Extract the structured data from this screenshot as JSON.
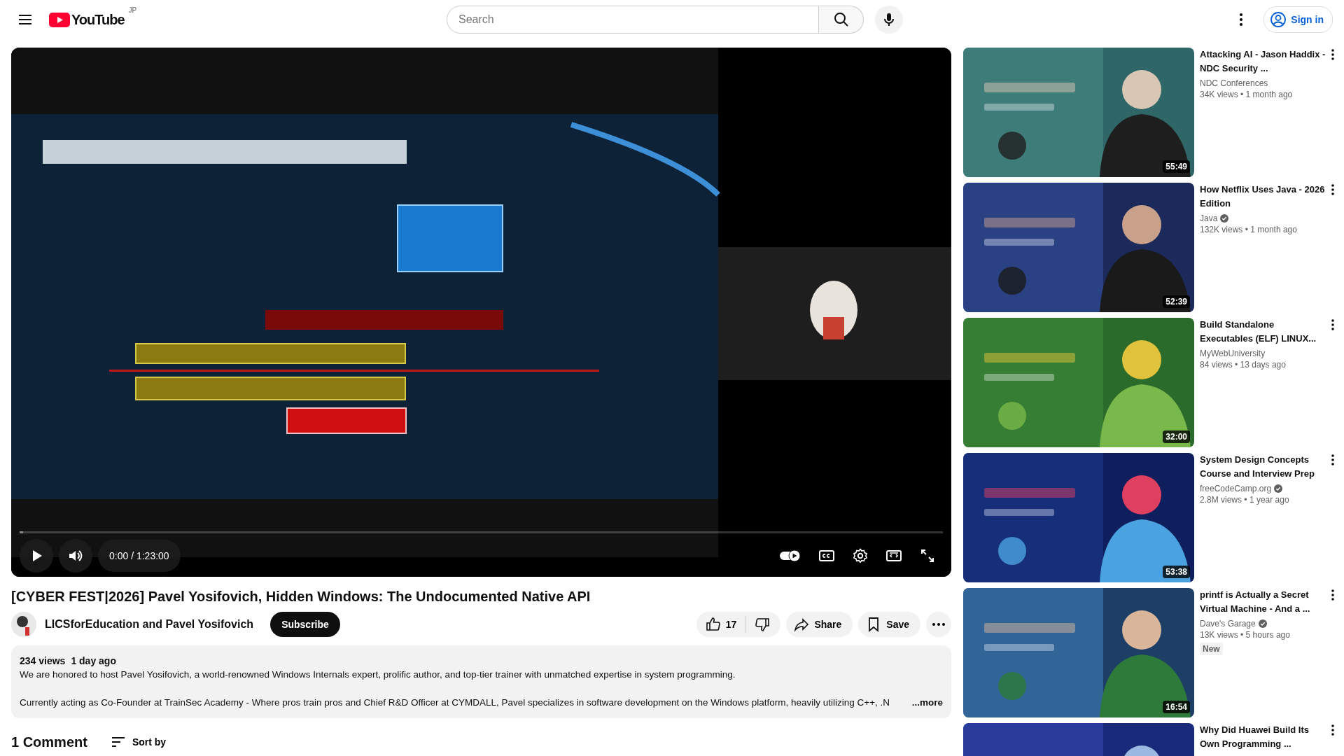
{
  "header": {
    "logo_text": "YouTube",
    "region": "JP",
    "search": {
      "placeholder": "Search"
    },
    "sign_in": "Sign in"
  },
  "player": {
    "time": "0:00 / 1:23:00",
    "progress": {
      "level": 0
    },
    "autoplay": {
      "on": true
    }
  },
  "video": {
    "title": "[CYBER FEST|2026] Pavel Yosifovich, Hidden Windows: The Undocumented Native API",
    "channel": "LICSforEducation and Pavel Yosifovich",
    "subscribe": "Subscribe",
    "likes": "17",
    "share": "Share",
    "save": "Save"
  },
  "description": {
    "views": "234 views",
    "date": "1 day ago",
    "lines": [
      "We are honored to host Pavel Yosifovich, a world-renowned Windows Internals expert, prolific author, and top-tier trainer with unmatched expertise in system programming.",
      "Currently acting as Co-Founder at TrainSec Academy - Where pros train pros and Chief R&D Officer at CYMDALL, Pavel specializes in software development on the Windows platform, heavily utilizing C++, .N"
    ],
    "more": "...more"
  },
  "comments": {
    "count": "1 Comment",
    "sort": "Sort by"
  },
  "related": [
    {
      "duration": "55:49",
      "title": "Attacking AI - Jason Haddix - NDC Security ...",
      "channel": "NDC Conferences",
      "verified": false,
      "stats": "34K views • 1 month ago"
    },
    {
      "duration": "52:39",
      "title": "How Netflix Uses Java - 2026 Edition",
      "channel": "Java",
      "verified": true,
      "stats": "132K views • 1 month ago"
    },
    {
      "duration": "32:00",
      "title": "Build Standalone Executables (ELF) LINUX...",
      "channel": "MyWebUniversity",
      "verified": false,
      "stats": "84 views • 13 days ago"
    },
    {
      "duration": "53:38",
      "title": "System Design Concepts Course and Interview Prep",
      "channel": "freeCodeCamp.org",
      "verified": true,
      "stats": "2.8M views • 1 year ago"
    },
    {
      "duration": "16:54",
      "title": "printf is Actually a Secret Virtual Machine - And a ...",
      "channel": "Dave's Garage",
      "verified": true,
      "stats": "13K views • 5 hours ago",
      "badge": "New"
    },
    {
      "title": "Why Did Huawei Build Its Own Programming ..."
    }
  ]
}
